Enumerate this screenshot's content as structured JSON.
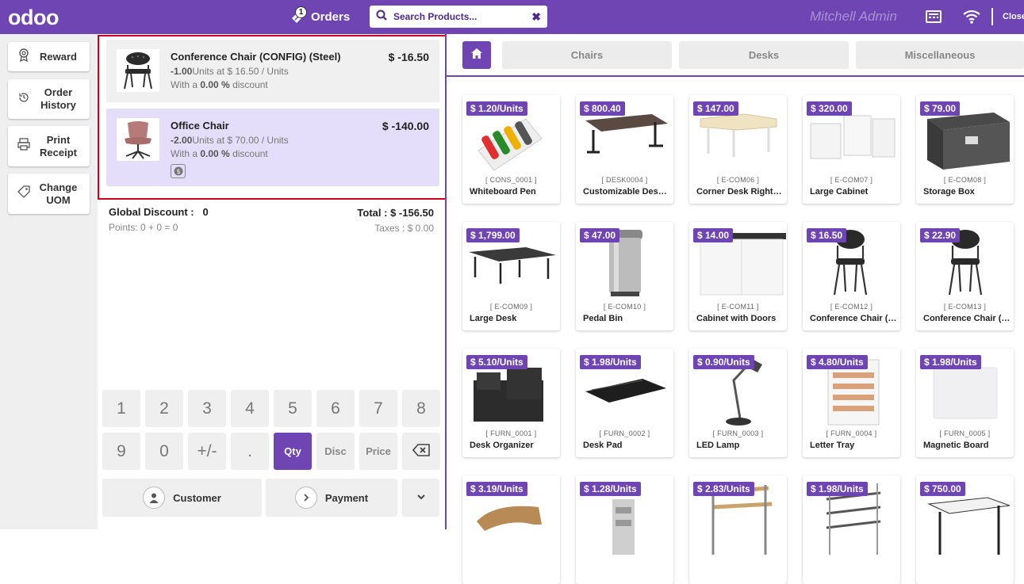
{
  "header": {
    "logo": "odoo",
    "orders_label": "Orders",
    "orders_count": "1",
    "search_placeholder": "Search Products...",
    "user_name": "Mitchell Admin",
    "close_label": "Close"
  },
  "control_buttons": [
    {
      "label": "Reward",
      "icon": "award-icon"
    },
    {
      "label": "Order History",
      "icon": "history-icon"
    },
    {
      "label": "Print Receipt",
      "icon": "printer-icon"
    },
    {
      "label": "Change UOM",
      "icon": "tag-icon"
    }
  ],
  "order_lines": [
    {
      "name": "Conference Chair (CONFIG) (Steel)",
      "price": "$ -16.50",
      "qty": "-1.00",
      "unit_text": "Units at $ 16.50 / Units",
      "discount_prefix": "With a",
      "discount": "0.00 %",
      "discount_suffix": "discount",
      "selected": false
    },
    {
      "name": "Office Chair",
      "price": "$ -140.00",
      "qty": "-2.00",
      "unit_text": "Units at $ 70.00 / Units",
      "discount_prefix": "With a",
      "discount": "0.00 %",
      "discount_suffix": "discount",
      "selected": true
    }
  ],
  "summary": {
    "global_discount_label": "Global Discount :",
    "global_discount_value": "0",
    "total": "Total : $ -156.50",
    "points": "Points: 0 + 0 = 0",
    "taxes": "Taxes : $ 0.00"
  },
  "numpad": {
    "row1": [
      "1",
      "2",
      "3",
      "4",
      "5",
      "6",
      "7",
      "8"
    ],
    "row2": [
      "9",
      "0",
      "+/-",
      ".",
      "Qty",
      "Disc",
      "Price",
      "⌫"
    ],
    "active_mode": "Qty"
  },
  "actions": {
    "customer": "Customer",
    "payment": "Payment"
  },
  "categories": [
    "Chairs",
    "Desks",
    "Miscellaneous"
  ],
  "products": [
    {
      "price": "$ 1.20/Units",
      "code": "[ CONS_0001 ]",
      "name": "Whiteboard Pen"
    },
    {
      "price": "$ 800.40",
      "code": "[ DESK0004 ]",
      "name": "Customizable Desk (Steel, White)"
    },
    {
      "price": "$ 147.00",
      "code": "[ E-COM06 ]",
      "name": "Corner Desk Right Sit"
    },
    {
      "price": "$ 320.00",
      "code": "[ E-COM07 ]",
      "name": "Large Cabinet"
    },
    {
      "price": "$ 79.00",
      "code": "[ E-COM08 ]",
      "name": "Storage Box"
    },
    {
      "price": "$ 1,799.00",
      "code": "[ E-COM09 ]",
      "name": "Large Desk"
    },
    {
      "price": "$ 47.00",
      "code": "[ E-COM10 ]",
      "name": "Pedal Bin"
    },
    {
      "price": "$ 14.00",
      "code": "[ E-COM11 ]",
      "name": "Cabinet with Doors"
    },
    {
      "price": "$ 16.50",
      "code": "[ E-COM12 ]",
      "name": "Conference Chair (Steel)"
    },
    {
      "price": "$ 22.90",
      "code": "[ E-COM13 ]",
      "name": "Conference Chair (Aluminium)"
    },
    {
      "price": "$ 5.10/Units",
      "code": "[ FURN_0001 ]",
      "name": "Desk Organizer"
    },
    {
      "price": "$ 1.98/Units",
      "code": "[ FURN_0002 ]",
      "name": "Desk Pad"
    },
    {
      "price": "$ 0.90/Units",
      "code": "[ FURN_0003 ]",
      "name": "LED Lamp"
    },
    {
      "price": "$ 4.80/Units",
      "code": "[ FURN_0004 ]",
      "name": "Letter Tray"
    },
    {
      "price": "$ 1.98/Units",
      "code": "[ FURN_0005 ]",
      "name": "Magnetic Board"
    },
    {
      "price": "$ 3.19/Units",
      "code": "",
      "name": ""
    },
    {
      "price": "$ 1.28/Units",
      "code": "",
      "name": ""
    },
    {
      "price": "$ 2.83/Units",
      "code": "",
      "name": ""
    },
    {
      "price": "$ 1.98/Units",
      "code": "",
      "name": ""
    },
    {
      "price": "$ 750.00",
      "code": "",
      "name": ""
    }
  ],
  "colors": {
    "accent": "#6f45b3",
    "selected_line": "#e5defa",
    "highlight_border": "#d1001f"
  }
}
